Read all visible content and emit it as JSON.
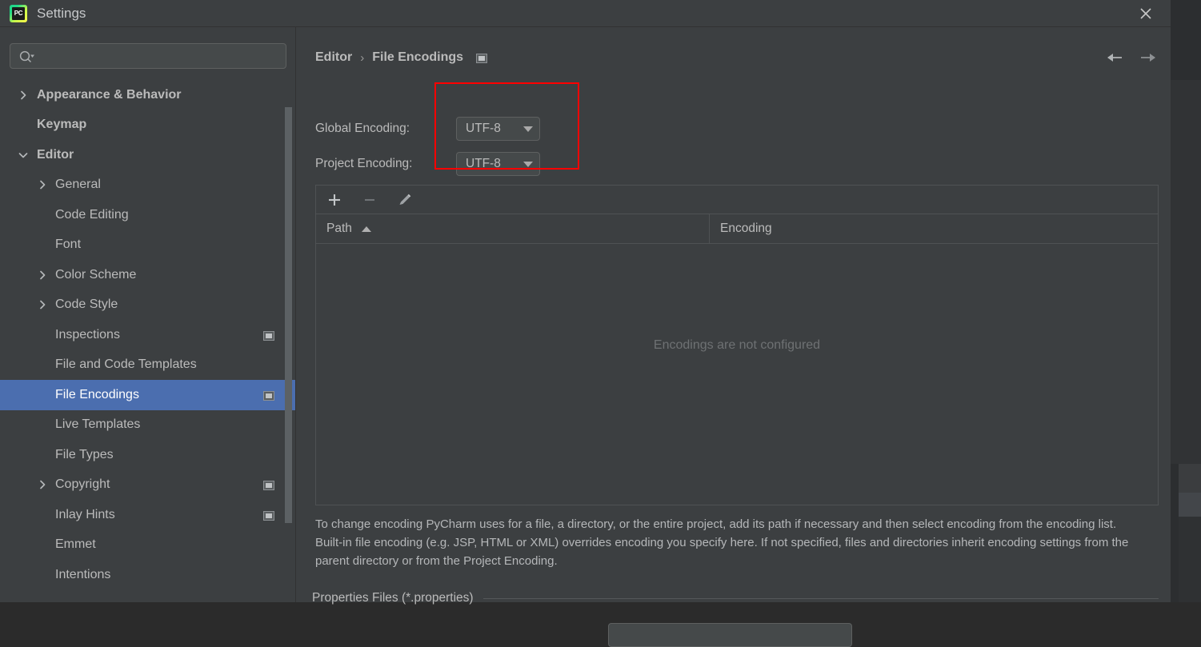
{
  "window": {
    "title": "Settings",
    "logo_text": "PC",
    "close_label": "×"
  },
  "sidebar": {
    "search": {
      "value": "",
      "placeholder": ""
    },
    "items": [
      {
        "label": "Appearance & Behavior",
        "level": 0,
        "expandable": true,
        "expanded": false,
        "bold": true,
        "selected": false,
        "scope_icon": false
      },
      {
        "label": "Keymap",
        "level": 0,
        "expandable": false,
        "expanded": false,
        "bold": true,
        "selected": false,
        "scope_icon": false
      },
      {
        "label": "Editor",
        "level": 0,
        "expandable": true,
        "expanded": true,
        "bold": true,
        "selected": false,
        "scope_icon": false
      },
      {
        "label": "General",
        "level": 1,
        "expandable": true,
        "expanded": false,
        "bold": false,
        "selected": false,
        "scope_icon": false
      },
      {
        "label": "Code Editing",
        "level": 1,
        "expandable": false,
        "expanded": false,
        "bold": false,
        "selected": false,
        "scope_icon": false
      },
      {
        "label": "Font",
        "level": 1,
        "expandable": false,
        "expanded": false,
        "bold": false,
        "selected": false,
        "scope_icon": false
      },
      {
        "label": "Color Scheme",
        "level": 1,
        "expandable": true,
        "expanded": false,
        "bold": false,
        "selected": false,
        "scope_icon": false
      },
      {
        "label": "Code Style",
        "level": 1,
        "expandable": true,
        "expanded": false,
        "bold": false,
        "selected": false,
        "scope_icon": false
      },
      {
        "label": "Inspections",
        "level": 1,
        "expandable": false,
        "expanded": false,
        "bold": false,
        "selected": false,
        "scope_icon": true
      },
      {
        "label": "File and Code Templates",
        "level": 1,
        "expandable": false,
        "expanded": false,
        "bold": false,
        "selected": false,
        "scope_icon": false
      },
      {
        "label": "File Encodings",
        "level": 1,
        "expandable": false,
        "expanded": false,
        "bold": false,
        "selected": true,
        "scope_icon": true
      },
      {
        "label": "Live Templates",
        "level": 1,
        "expandable": false,
        "expanded": false,
        "bold": false,
        "selected": false,
        "scope_icon": false
      },
      {
        "label": "File Types",
        "level": 1,
        "expandable": false,
        "expanded": false,
        "bold": false,
        "selected": false,
        "scope_icon": false
      },
      {
        "label": "Copyright",
        "level": 1,
        "expandable": true,
        "expanded": false,
        "bold": false,
        "selected": false,
        "scope_icon": true
      },
      {
        "label": "Inlay Hints",
        "level": 1,
        "expandable": false,
        "expanded": false,
        "bold": false,
        "selected": false,
        "scope_icon": true
      },
      {
        "label": "Emmet",
        "level": 1,
        "expandable": false,
        "expanded": false,
        "bold": false,
        "selected": false,
        "scope_icon": false
      },
      {
        "label": "Intentions",
        "level": 1,
        "expandable": false,
        "expanded": false,
        "bold": false,
        "selected": false,
        "scope_icon": false
      }
    ]
  },
  "content": {
    "breadcrumb": {
      "parent": "Editor",
      "separator": "›",
      "current": "File Encodings"
    },
    "global_encoding": {
      "label": "Global Encoding:",
      "value": "UTF-8"
    },
    "project_encoding": {
      "label": "Project Encoding:",
      "value": "UTF-8"
    },
    "toolbar": {
      "add_label": "+",
      "remove_label": "−",
      "edit_label": "edit"
    },
    "table": {
      "columns": [
        "Path",
        "Encoding"
      ],
      "sort_column": "Path",
      "sort_direction": "asc",
      "rows": [],
      "empty_message": "Encodings are not configured"
    },
    "description": "To change encoding PyCharm uses for a file, a directory, or the entire project, add its path if necessary and then select encoding from the encoding list. Built-in file encoding (e.g. JSP, HTML or XML) overrides encoding you specify here. If not specified, files and directories inherit encoding settings from the parent directory or from the Project Encoding.",
    "properties_section": {
      "title": "Properties Files (*.properties)"
    }
  },
  "annotation": {
    "color": "#ff0000"
  }
}
